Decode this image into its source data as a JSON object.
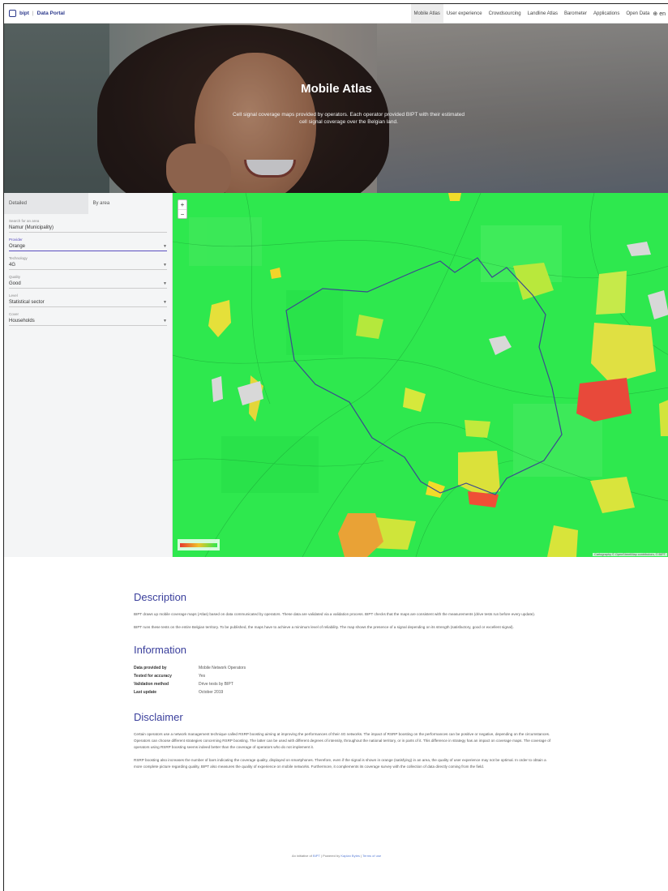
{
  "nav": {
    "brand_name": "bipt",
    "portal_name": "Data Portal",
    "links": [
      {
        "label": "Mobile Atlas",
        "active": true
      },
      {
        "label": "User experience",
        "active": false
      },
      {
        "label": "Crowdsourcing",
        "active": false
      },
      {
        "label": "Landline Atlas",
        "active": false
      },
      {
        "label": "Barometer",
        "active": false
      },
      {
        "label": "Applications",
        "active": false
      },
      {
        "label": "Open Data",
        "active": false
      }
    ],
    "lang": "en"
  },
  "hero": {
    "title": "Mobile Atlas",
    "subtitle": "Cell signal coverage maps provided by operators. Each operator provided BIPT with their estimated cell signal coverage over the Belgian land."
  },
  "sidebar": {
    "tabs": [
      "Detailed",
      "By area"
    ],
    "fields": [
      {
        "label": "Search for an area",
        "value": "Namur (Municipality)",
        "dropdown": false
      },
      {
        "label": "Provider",
        "value": "Orange",
        "dropdown": true,
        "focused": true
      },
      {
        "label": "Technology",
        "value": "4G",
        "dropdown": true
      },
      {
        "label": "Quality",
        "value": "Good",
        "dropdown": true
      },
      {
        "label": "Level",
        "value": "Statistical sector",
        "dropdown": true
      },
      {
        "label": "Cover",
        "value": "Households",
        "dropdown": true
      }
    ]
  },
  "map": {
    "zoom_in": "+",
    "zoom_out": "−",
    "attribution": "Cartography © OpenStreetMap contributors, © BIPT",
    "colors": {
      "excellent": "#2ee84e",
      "good": "#c8e83a",
      "fair": "#f0d02a",
      "poor": "#e53a2c"
    }
  },
  "description": {
    "heading": "Description",
    "paragraphs": [
      "BIPT draws up mobile coverage maps (Atlas) based on data communicated by operators. These data are validated via a validation process. BIPT checks that the maps are consistent with the measurements (drive tests run before every update).",
      "BIPT runs these tests on the entire Belgian territory. To be published, the maps have to achieve a minimum level of reliability. The map shows the presence of a signal depending on its strength (satisfactory, good or excellent signal)."
    ]
  },
  "information": {
    "heading": "Information",
    "rows": [
      {
        "key": "Data provided by",
        "value": "Mobile Network Operators"
      },
      {
        "key": "Tested for accuracy",
        "value": "Yes"
      },
      {
        "key": "Validation method",
        "value": "Drive tests by BIPT"
      },
      {
        "key": "Last update",
        "value": "October 2019"
      }
    ]
  },
  "disclaimer": {
    "heading": "Disclaimer",
    "paragraphs": [
      "Certain operators use a network management technique called RSRP boosting aiming at improving the performances of their 4G networks. The impact of RSRP boosting on the performances can be positive or negative, depending on the circumstances. Operators can choose different strategies concerning RSRP boosting. The latter can be used with different degrees of intensity, throughout the national territory, or in parts of it. This difference in strategy has an impact on coverage maps. The coverage of operators using RSRP boosting seems indeed better than the coverage of operators who do not implement it.",
      "RSRP boosting also increases the number of bars indicating the coverage quality, displayed on smartphones. Therefore, even if the signal is shown in orange (satisfying) in an area, the quality of user experience may not be optimal. In order to obtain a more complete picture regarding quality, BIPT also measures the quality of experience on mobile networks. Furthermore, it complements its coverage survey with the collection of data directly coming from the field."
    ]
  },
  "footer": {
    "prefix": "An initiative of",
    "org": "BIPT",
    "sep1": "|",
    "powered": "Powered by",
    "powered_link": "Kaplan Bytes",
    "sep2": "|",
    "terms": "Terms of use"
  }
}
